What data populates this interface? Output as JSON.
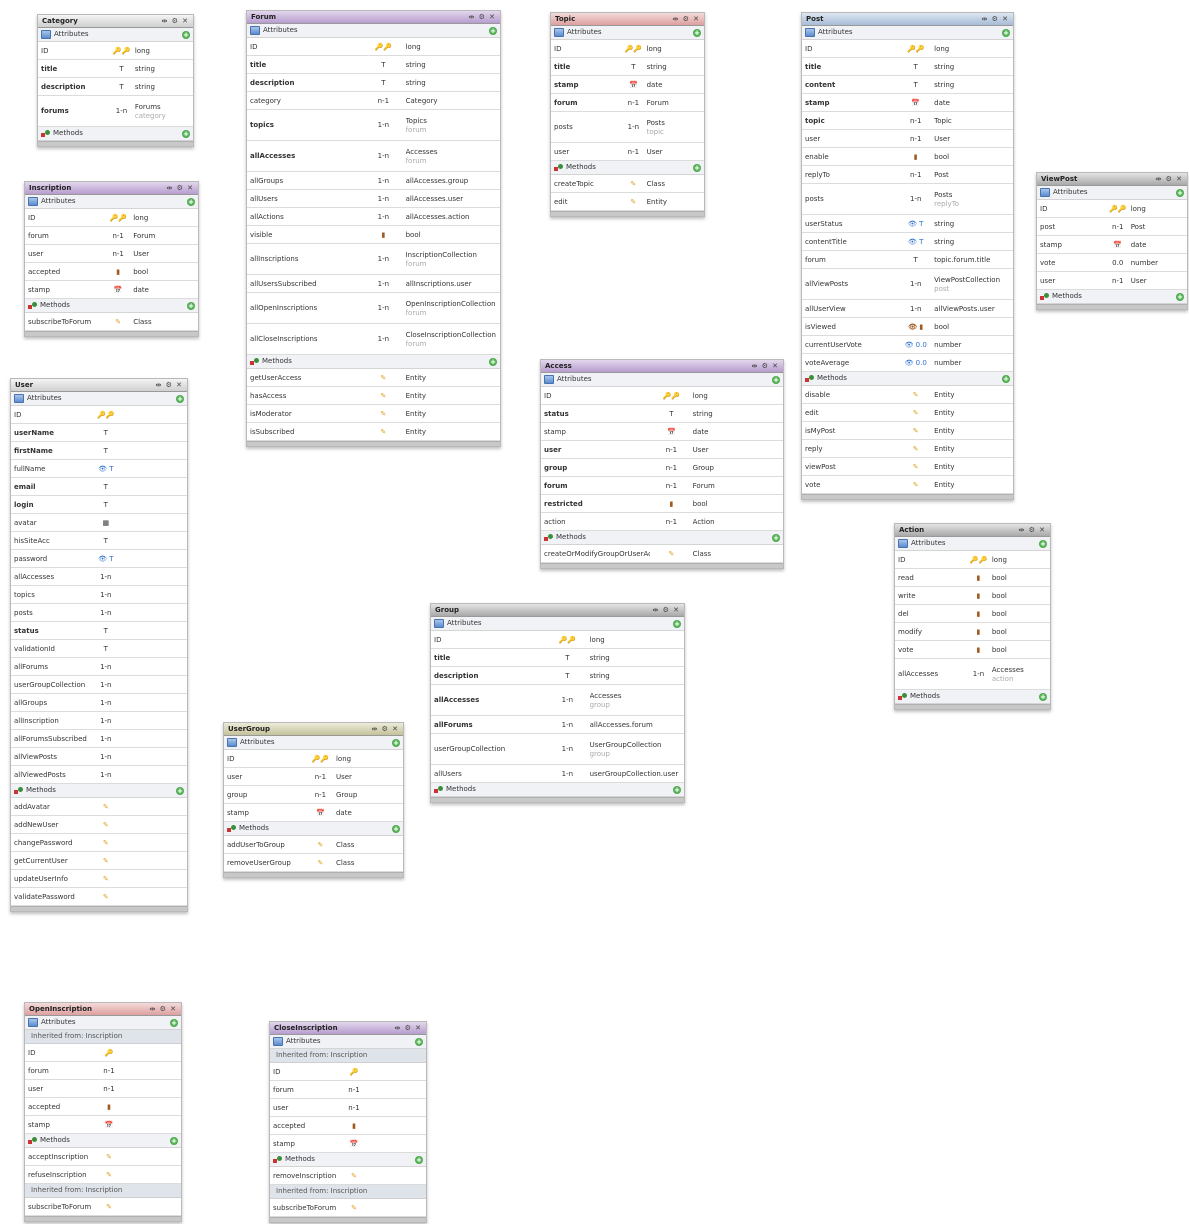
{
  "labels": {
    "attributes": "Attributes",
    "methods": "Methods",
    "inherited_from_inscription": "Inherited from: Inscription",
    "window_controls": "⇹ ⚙ ✕"
  },
  "icons": {
    "attribute": "attributes-icon",
    "method": "methods-icon",
    "add": "add-icon",
    "key": "key-icon",
    "type_string": "T",
    "type_date": "calendar-icon",
    "type_bool": "bool-icon",
    "method_marker": "pencil-icon"
  },
  "entities": [
    {
      "id": "category",
      "title": "Category",
      "header": "cat",
      "attributes": [
        {
          "name": "ID",
          "mark": "🔑🔑",
          "type": "long"
        },
        {
          "name": "title",
          "mark": "T",
          "type": "string",
          "bold": true
        },
        {
          "name": "description",
          "mark": "T",
          "type": "string",
          "bold": true
        },
        {
          "name": "forums",
          "mark": "1-n",
          "type": "Forums",
          "sub": "category",
          "bold": true
        }
      ],
      "methods": []
    },
    {
      "id": "inscription",
      "title": "Inscription",
      "header": "purple",
      "attributes": [
        {
          "name": "ID",
          "mark": "🔑🔑",
          "type": "long"
        },
        {
          "name": "forum",
          "mark": "n-1",
          "type": "Forum"
        },
        {
          "name": "user",
          "mark": "n-1",
          "type": "User"
        },
        {
          "name": "accepted",
          "mark": "▮",
          "type": "bool"
        },
        {
          "name": "stamp",
          "mark": "📅",
          "type": "date"
        }
      ],
      "methods": [
        {
          "name": "subscribeToForum",
          "type": "Class"
        }
      ]
    },
    {
      "id": "user",
      "title": "User",
      "header": "cat",
      "attributes": [
        {
          "name": "ID",
          "mark": "🔑🔑",
          "type": ""
        },
        {
          "name": "userName",
          "mark": "T",
          "type": "",
          "bold": true
        },
        {
          "name": "firstName",
          "mark": "T",
          "type": "",
          "bold": true
        },
        {
          "name": "fullName",
          "mark": "👁 T",
          "type": ""
        },
        {
          "name": "email",
          "mark": "T",
          "type": "",
          "bold": true
        },
        {
          "name": "login",
          "mark": "T",
          "type": "",
          "bold": true
        },
        {
          "name": "avatar",
          "mark": "▦",
          "type": ""
        },
        {
          "name": "hisSiteAcc",
          "mark": "T",
          "type": ""
        },
        {
          "name": "password",
          "mark": "👁 T",
          "type": ""
        },
        {
          "name": "allAccesses",
          "mark": "1-n",
          "type": ""
        },
        {
          "name": "topics",
          "mark": "1-n",
          "type": ""
        },
        {
          "name": "posts",
          "mark": "1-n",
          "type": ""
        },
        {
          "name": "status",
          "mark": "T",
          "type": "",
          "bold": true
        },
        {
          "name": "validationId",
          "mark": "T",
          "type": ""
        },
        {
          "name": "allForums",
          "mark": "1-n",
          "type": ""
        },
        {
          "name": "userGroupCollection",
          "mark": "1-n",
          "type": ""
        },
        {
          "name": "allGroups",
          "mark": "1-n",
          "type": ""
        },
        {
          "name": "allInscription",
          "mark": "1-n",
          "type": ""
        },
        {
          "name": "allForumsSubscribed",
          "mark": "1-n",
          "type": ""
        },
        {
          "name": "allViewPosts",
          "mark": "1-n",
          "type": ""
        },
        {
          "name": "allViewedPosts",
          "mark": "1-n",
          "type": ""
        }
      ],
      "methods": [
        {
          "name": "addAvatar",
          "type": ""
        },
        {
          "name": "addNewUser",
          "type": ""
        },
        {
          "name": "changePassword",
          "type": ""
        },
        {
          "name": "getCurrentUser",
          "type": ""
        },
        {
          "name": "updateUserInfo",
          "type": ""
        },
        {
          "name": "validatePassword",
          "type": ""
        }
      ]
    },
    {
      "id": "forum",
      "title": "Forum",
      "header": "purple",
      "attributes": [
        {
          "name": "ID",
          "mark": "🔑🔑",
          "type": "long"
        },
        {
          "name": "title",
          "mark": "T",
          "type": "string",
          "bold": true
        },
        {
          "name": "description",
          "mark": "T",
          "type": "string",
          "bold": true
        },
        {
          "name": "category",
          "mark": "n-1",
          "type": "Category"
        },
        {
          "name": "topics",
          "mark": "1-n",
          "type": "Topics",
          "sub": "forum",
          "bold": true
        },
        {
          "name": "allAccesses",
          "mark": "1-n",
          "type": "Accesses",
          "sub": "forum",
          "bold": true
        },
        {
          "name": "allGroups",
          "mark": "1-n",
          "type": "allAccesses.group"
        },
        {
          "name": "allUsers",
          "mark": "1-n",
          "type": "allAccesses.user"
        },
        {
          "name": "allActions",
          "mark": "1-n",
          "type": "allAccesses.action"
        },
        {
          "name": "visible",
          "mark": "▮",
          "type": "bool"
        },
        {
          "name": "allInscriptions",
          "mark": "1-n",
          "type": "InscriptionCollection",
          "sub": "forum"
        },
        {
          "name": "allUsersSubscribed",
          "mark": "1-n",
          "type": "allInscriptions.user"
        },
        {
          "name": "allOpenInscriptions",
          "mark": "1-n",
          "type": "OpenInscriptionCollection",
          "sub": "forum"
        },
        {
          "name": "allCloseInscriptions",
          "mark": "1-n",
          "type": "CloseInscriptionCollection",
          "sub": "forum"
        }
      ],
      "methods": [
        {
          "name": "getUserAccess",
          "type": "Entity"
        },
        {
          "name": "hasAccess",
          "type": "Entity"
        },
        {
          "name": "isModerator",
          "type": "Entity"
        },
        {
          "name": "isSubscribed",
          "type": "Entity"
        }
      ]
    },
    {
      "id": "usergroup",
      "title": "UserGroup",
      "header": "olive",
      "attributes": [
        {
          "name": "ID",
          "mark": "🔑🔑",
          "type": "long"
        },
        {
          "name": "user",
          "mark": "n-1",
          "type": "User"
        },
        {
          "name": "group",
          "mark": "n-1",
          "type": "Group"
        },
        {
          "name": "stamp",
          "mark": "📅",
          "type": "date"
        }
      ],
      "methods": [
        {
          "name": "addUserToGroup",
          "type": "Class"
        },
        {
          "name": "removeUserGroup",
          "type": "Class"
        }
      ]
    },
    {
      "id": "topic",
      "title": "Topic",
      "header": "pink",
      "attributes": [
        {
          "name": "ID",
          "mark": "🔑🔑",
          "type": "long"
        },
        {
          "name": "title",
          "mark": "T",
          "type": "string",
          "bold": true
        },
        {
          "name": "stamp",
          "mark": "📅",
          "type": "date",
          "bold": true
        },
        {
          "name": "forum",
          "mark": "n-1",
          "type": "Forum",
          "bold": true
        },
        {
          "name": "posts",
          "mark": "1-n",
          "type": "Posts",
          "sub": "topic"
        },
        {
          "name": "user",
          "mark": "n-1",
          "type": "User"
        }
      ],
      "methods": [
        {
          "name": "createTopic",
          "type": "Class"
        },
        {
          "name": "edit",
          "type": "Entity"
        }
      ]
    },
    {
      "id": "access",
      "title": "Access",
      "header": "purple",
      "attributes": [
        {
          "name": "ID",
          "mark": "🔑🔑",
          "type": "long"
        },
        {
          "name": "status",
          "mark": "T",
          "type": "string",
          "bold": true
        },
        {
          "name": "stamp",
          "mark": "📅",
          "type": "date"
        },
        {
          "name": "user",
          "mark": "n-1",
          "type": "User",
          "bold": true
        },
        {
          "name": "group",
          "mark": "n-1",
          "type": "Group",
          "bold": true
        },
        {
          "name": "forum",
          "mark": "n-1",
          "type": "Forum",
          "bold": true
        },
        {
          "name": "restricted",
          "mark": "▮",
          "type": "bool",
          "bold": true
        },
        {
          "name": "action",
          "mark": "n-1",
          "type": "Action"
        }
      ],
      "methods": [
        {
          "name": "createOrModifyGroupOrUserAccess",
          "type": "Class"
        }
      ]
    },
    {
      "id": "group",
      "title": "Group",
      "header": "gray",
      "attributes": [
        {
          "name": "ID",
          "mark": "🔑🔑",
          "type": "long"
        },
        {
          "name": "title",
          "mark": "T",
          "type": "string",
          "bold": true
        },
        {
          "name": "description",
          "mark": "T",
          "type": "string",
          "bold": true
        },
        {
          "name": "allAccesses",
          "mark": "1-n",
          "type": "Accesses",
          "sub": "group",
          "bold": true
        },
        {
          "name": "allForums",
          "mark": "1-n",
          "type": "allAccesses.forum",
          "bold": true
        },
        {
          "name": "userGroupCollection",
          "mark": "1-n",
          "type": "UserGroupCollection",
          "sub": "group"
        },
        {
          "name": "allUsers",
          "mark": "1-n",
          "type": "userGroupCollection.user"
        }
      ],
      "methods": []
    },
    {
      "id": "post",
      "title": "Post",
      "header": "blue",
      "attributes": [
        {
          "name": "ID",
          "mark": "🔑🔑",
          "type": "long"
        },
        {
          "name": "title",
          "mark": "T",
          "type": "string",
          "bold": true
        },
        {
          "name": "content",
          "mark": "T",
          "type": "string",
          "bold": true
        },
        {
          "name": "stamp",
          "mark": "📅",
          "type": "date",
          "bold": true
        },
        {
          "name": "topic",
          "mark": "n-1",
          "type": "Topic",
          "bold": true
        },
        {
          "name": "user",
          "mark": "n-1",
          "type": "User"
        },
        {
          "name": "enable",
          "mark": "▮",
          "type": "bool"
        },
        {
          "name": "replyTo",
          "mark": "n-1",
          "type": "Post"
        },
        {
          "name": "posts",
          "mark": "1-n",
          "type": "Posts",
          "sub": "replyTo"
        },
        {
          "name": "userStatus",
          "mark": "👁 T",
          "type": "string"
        },
        {
          "name": "contentTitle",
          "mark": "👁 T",
          "type": "string"
        },
        {
          "name": "forum",
          "mark": "T",
          "type": "topic.forum.title"
        },
        {
          "name": "allViewPosts",
          "mark": "1-n",
          "type": "ViewPostCollection",
          "sub": "post"
        },
        {
          "name": "allUserView",
          "mark": "1-n",
          "type": "allViewPosts.user"
        },
        {
          "name": "isViewed",
          "mark": "👁 ▮",
          "type": "bool"
        },
        {
          "name": "currentUserVote",
          "mark": "👁 0.0",
          "type": "number"
        },
        {
          "name": "voteAverage",
          "mark": "👁 0.0",
          "type": "number"
        }
      ],
      "methods": [
        {
          "name": "disable",
          "type": "Entity"
        },
        {
          "name": "edit",
          "type": "Entity"
        },
        {
          "name": "isMyPost",
          "type": "Entity"
        },
        {
          "name": "reply",
          "type": "Entity"
        },
        {
          "name": "viewPost",
          "type": "Entity"
        },
        {
          "name": "vote",
          "type": "Entity"
        }
      ]
    },
    {
      "id": "viewpost",
      "title": "ViewPost",
      "header": "gray",
      "attributes": [
        {
          "name": "ID",
          "mark": "🔑🔑",
          "type": "long"
        },
        {
          "name": "post",
          "mark": "n-1",
          "type": "Post"
        },
        {
          "name": "stamp",
          "mark": "📅",
          "type": "date"
        },
        {
          "name": "vote",
          "mark": "0.0",
          "type": "number"
        },
        {
          "name": "user",
          "mark": "n-1",
          "type": "User"
        }
      ],
      "methods": []
    },
    {
      "id": "action",
      "title": "Action",
      "header": "gray",
      "attributes": [
        {
          "name": "ID",
          "mark": "🔑🔑",
          "type": "long"
        },
        {
          "name": "read",
          "mark": "▮",
          "type": "bool"
        },
        {
          "name": "write",
          "mark": "▮",
          "type": "bool"
        },
        {
          "name": "del",
          "mark": "▮",
          "type": "bool"
        },
        {
          "name": "modify",
          "mark": "▮",
          "type": "bool"
        },
        {
          "name": "vote",
          "mark": "▮",
          "type": "bool"
        },
        {
          "name": "allAccesses",
          "mark": "1-n",
          "type": "Accesses",
          "sub": "action"
        }
      ],
      "methods": []
    },
    {
      "id": "openinscription",
      "title": "OpenInscription",
      "header": "pink",
      "inherited_attributes": true,
      "attributes": [
        {
          "name": "ID",
          "mark": "🔑",
          "type": ""
        },
        {
          "name": "forum",
          "mark": "n-1",
          "type": ""
        },
        {
          "name": "user",
          "mark": "n-1",
          "type": ""
        },
        {
          "name": "accepted",
          "mark": "▮",
          "type": ""
        },
        {
          "name": "stamp",
          "mark": "📅",
          "type": ""
        }
      ],
      "methods": [
        {
          "name": "acceptInscription",
          "type": ""
        },
        {
          "name": "refuseInscription",
          "type": ""
        }
      ],
      "inherited_methods": [
        {
          "name": "subscribeToForum",
          "type": ""
        }
      ]
    },
    {
      "id": "closeinscription",
      "title": "CloseInscription",
      "header": "purple",
      "inherited_attributes": true,
      "attributes": [
        {
          "name": "ID",
          "mark": "🔑",
          "type": ""
        },
        {
          "name": "forum",
          "mark": "n-1",
          "type": ""
        },
        {
          "name": "user",
          "mark": "n-1",
          "type": ""
        },
        {
          "name": "accepted",
          "mark": "▮",
          "type": ""
        },
        {
          "name": "stamp",
          "mark": "📅",
          "type": ""
        }
      ],
      "methods": [
        {
          "name": "removeInscription",
          "type": ""
        }
      ],
      "inherited_methods": [
        {
          "name": "subscribeToForum",
          "type": ""
        }
      ]
    }
  ]
}
